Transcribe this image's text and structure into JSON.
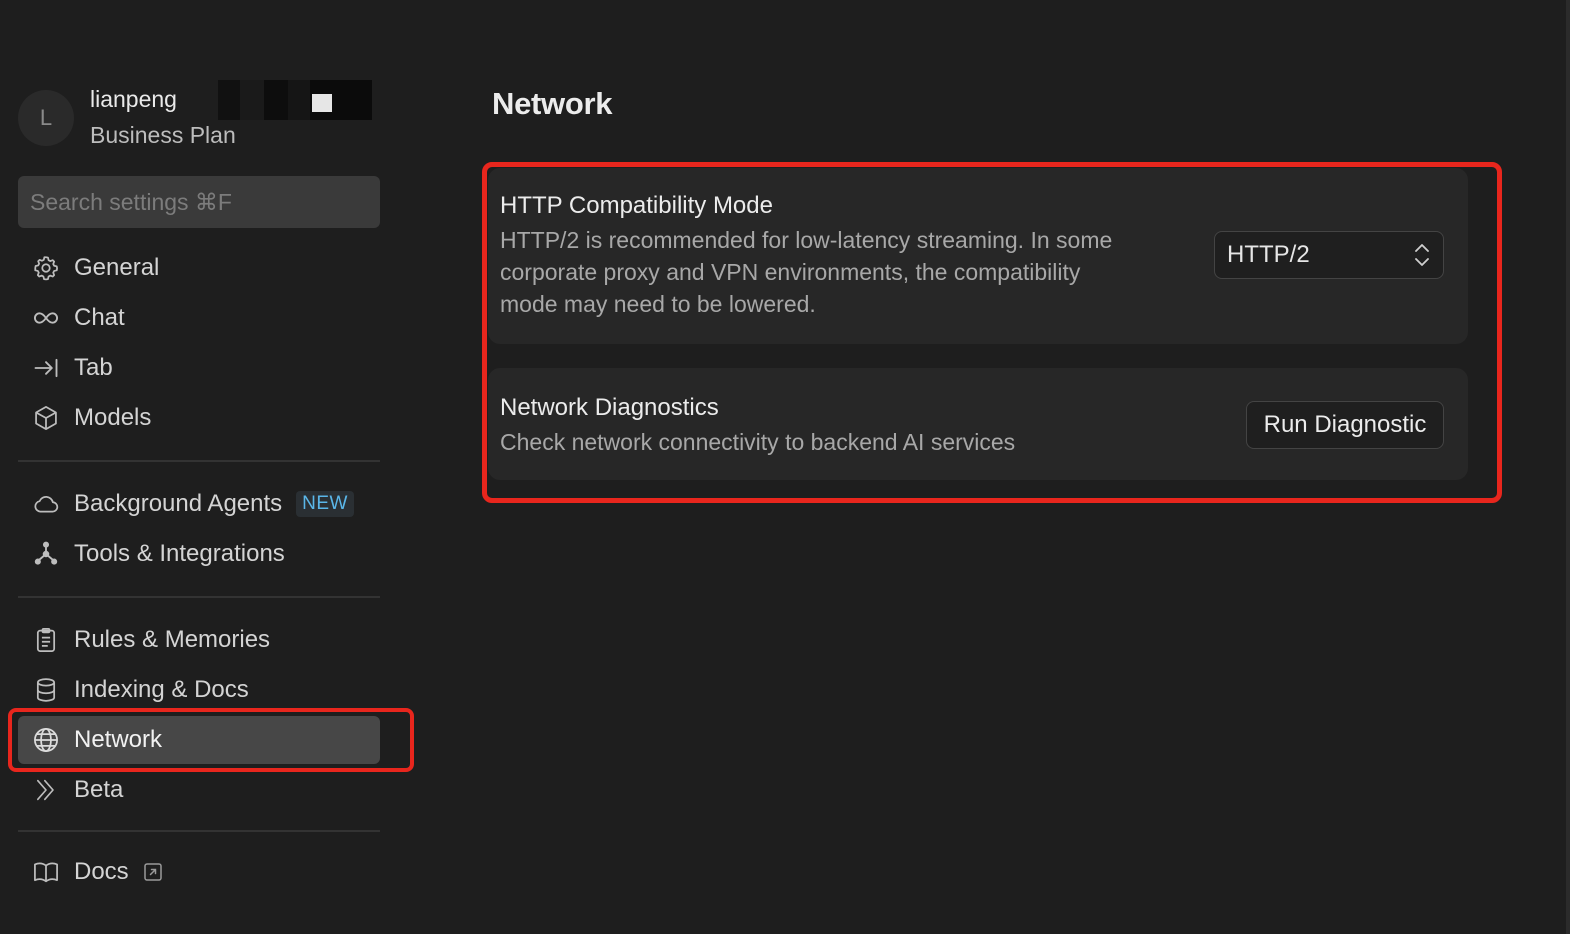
{
  "user": {
    "avatar_initial": "L",
    "name": "lianpeng",
    "plan": "Business Plan"
  },
  "search": {
    "placeholder": "Search settings ⌘F"
  },
  "sidebar": {
    "items": [
      {
        "label": "General",
        "icon": "gear-icon"
      },
      {
        "label": "Chat",
        "icon": "infinity-icon"
      },
      {
        "label": "Tab",
        "icon": "arrow-to-line-icon"
      },
      {
        "label": "Models",
        "icon": "cube-icon"
      },
      {
        "label": "Background Agents",
        "icon": "cloud-icon",
        "badge": "NEW"
      },
      {
        "label": "Tools & Integrations",
        "icon": "network-nodes-icon"
      },
      {
        "label": "Rules & Memories",
        "icon": "clipboard-icon"
      },
      {
        "label": "Indexing & Docs",
        "icon": "database-icon"
      },
      {
        "label": "Network",
        "icon": "globe-icon",
        "active": true
      },
      {
        "label": "Beta",
        "icon": "double-chevron-icon"
      },
      {
        "label": "Docs",
        "icon": "book-icon",
        "external": true
      }
    ]
  },
  "main": {
    "title": "Network",
    "http_mode": {
      "title": "HTTP Compatibility Mode",
      "description": "HTTP/2 is recommended for low-latency streaming. In some corporate proxy and VPN environments, the compatibility mode may need to be lowered.",
      "selected": "HTTP/2"
    },
    "diagnostics": {
      "title": "Network Diagnostics",
      "description": "Check network connectivity to backend AI services",
      "button_label": "Run Diagnostic"
    }
  },
  "colors": {
    "background": "#1e1e1e",
    "card": "#272727",
    "active_item": "#474747",
    "highlight": "#e8261d",
    "badge_text": "#5ab6e8"
  }
}
